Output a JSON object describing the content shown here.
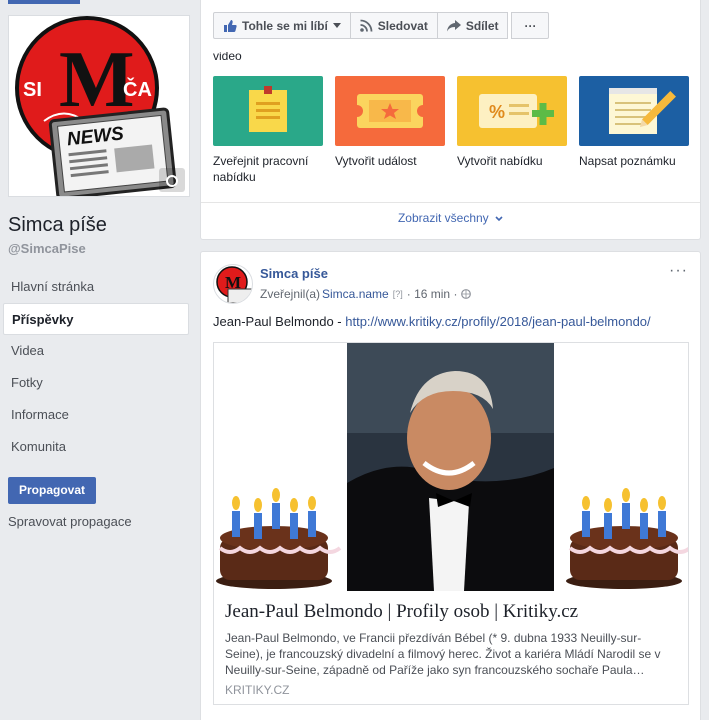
{
  "sidebar": {
    "page_name": "Simca píše",
    "page_handle": "@SimcaPise",
    "logo_text": {
      "m": "M",
      "left": "SI",
      "right": "ČA",
      "badge": "NEWS"
    },
    "nav": [
      {
        "label": "Hlavní stránka",
        "active": false
      },
      {
        "label": "Příspěvky",
        "active": true
      },
      {
        "label": "Videa",
        "active": false
      },
      {
        "label": "Fotky",
        "active": false
      },
      {
        "label": "Informace",
        "active": false
      },
      {
        "label": "Komunita",
        "active": false
      }
    ],
    "promote_label": "Propagovat",
    "manage_label": "Spravovat propagace"
  },
  "action_bar": {
    "like_label": "Tohle se mi líbí",
    "follow_label": "Sledovat",
    "share_label": "Sdílet",
    "more_label": "···"
  },
  "create_card": {
    "video_label": "video",
    "tiles": [
      {
        "label": "Zveřejnit pracovní nabídku",
        "color": "#2aa889",
        "icon": "job-note-icon"
      },
      {
        "label": "Vytvořit událost",
        "color": "#f56a3c",
        "icon": "event-ticket-icon"
      },
      {
        "label": "Vytvořit nabídku",
        "color": "#f6c130",
        "icon": "offer-percent-icon"
      },
      {
        "label": "Napsat poznámku",
        "color": "#1c5fa3",
        "icon": "note-pencil-icon"
      }
    ],
    "show_all_label": "Zobrazit všechny"
  },
  "post": {
    "author": "Simca píše",
    "published_by_prefix": "Zveřejnil(a)",
    "published_by": "Simca.name",
    "help_badge": "[?]",
    "time": "16 min",
    "text_prefix": "Jean-Paul Belmondo - ",
    "link_url": "http://www.kritiky.cz/profily/2018/jean-paul-belmondo/",
    "link_card": {
      "title": "Jean-Paul Belmondo | Profily osob | Kritiky.cz",
      "description": "Jean-Paul Belmondo, ve Francii přezdíván Bébel (* 9. dubna 1933 Neuilly-sur-Seine), je francouzský divadelní a filmový herec. Život a kariéra Mládí Narodil se v Neuilly-sur-Seine, západně od Paříže jako syn francouzského sochaře Paula…",
      "domain": "KRITIKY.CZ"
    }
  },
  "colors": {
    "fb_blue": "#4267b2",
    "link_blue": "#365899",
    "background": "#e9ebee"
  }
}
